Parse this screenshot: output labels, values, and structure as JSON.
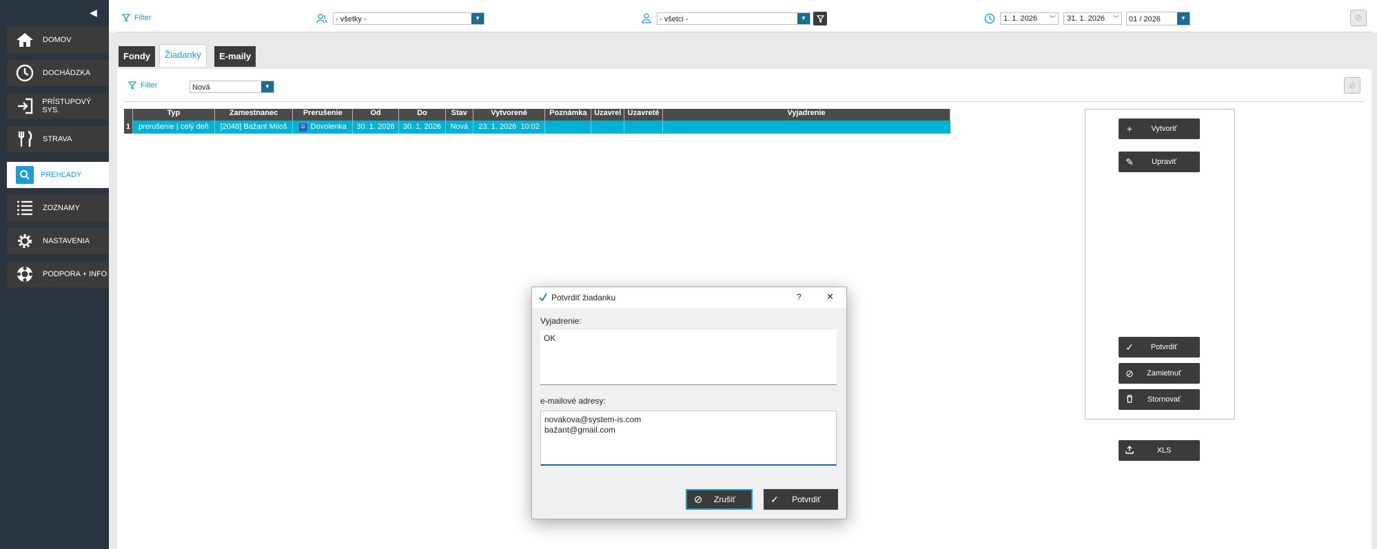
{
  "sidebar": {
    "items": [
      {
        "label": "DOMOV",
        "icon": "home-icon"
      },
      {
        "label": "DOCHÁDZKA",
        "icon": "clock-icon"
      },
      {
        "label": "PRÍSTUPOVÝ SYS.",
        "icon": "login-icon"
      },
      {
        "label": "STRAVA",
        "icon": "fork-knife-icon"
      },
      {
        "label": "PREHĽADY",
        "icon": "search-icon"
      },
      {
        "label": "ZOZNAMY",
        "icon": "list-icon"
      },
      {
        "label": "NASTAVENIA",
        "icon": "gear-icon"
      },
      {
        "label": "PODPORA + INFO",
        "icon": "lifebuoy-icon"
      }
    ],
    "active_index": 4
  },
  "topbar": {
    "filter_label": "Filter",
    "group_select": "- všetky -",
    "person_select": "- všetci -",
    "date_from": "1. 1. 2026",
    "date_to": "31. 1. 2026",
    "period": "01 / 2026"
  },
  "tabs": [
    "Fondy",
    "Žiadanky",
    "E-maily"
  ],
  "active_tab": 1,
  "content": {
    "filter_label": "Filter",
    "status_select": "Nová"
  },
  "grid": {
    "columns": [
      "Typ",
      "Zamestnanec",
      "Prerušenie",
      "Od",
      "Do",
      "Stav",
      "Vytvorené",
      "Poznámka",
      "Uzavrel",
      "Uzavreté",
      "Vyjadrenie"
    ],
    "rows": [
      {
        "num": "1",
        "typ": "prerušenie | celý deň",
        "zamestnanec": "[2048] Bažant Miloš",
        "prerusenie_badge": "D",
        "prerusenie": "Dovolenka",
        "od": "30. 1. 2026",
        "do": "30. 1. 2026",
        "stav": "Nová",
        "vytvorene": "23. 1. 2026  10:02",
        "poznamka": "",
        "uzavrel": "",
        "uzavrete": "",
        "vyjadrenie": ""
      }
    ]
  },
  "actions": {
    "create": "Vytvoriť",
    "edit": "Upraviť",
    "confirm": "Potvrdiť",
    "reject": "Zamietnuť",
    "cancel": "Stornovať",
    "export": "XLS"
  },
  "dialog": {
    "title": "Potvrdiť žiadanku",
    "help": "?",
    "close": "✕",
    "comment_label": "Vyjadrenie:",
    "comment_value": "OK",
    "emails_label": "e-mailové adresy:",
    "emails_value": "novakova@system-is.com\nbažant@gmail.com",
    "cancel_label": "Zrušiť",
    "confirm_label": "Potvrdiť"
  },
  "colors": {
    "sidebar_bg": "#2a3540",
    "accent": "#1b9bd8",
    "row_selected": "#00b3d6",
    "button_dark": "#3b3b3b"
  }
}
